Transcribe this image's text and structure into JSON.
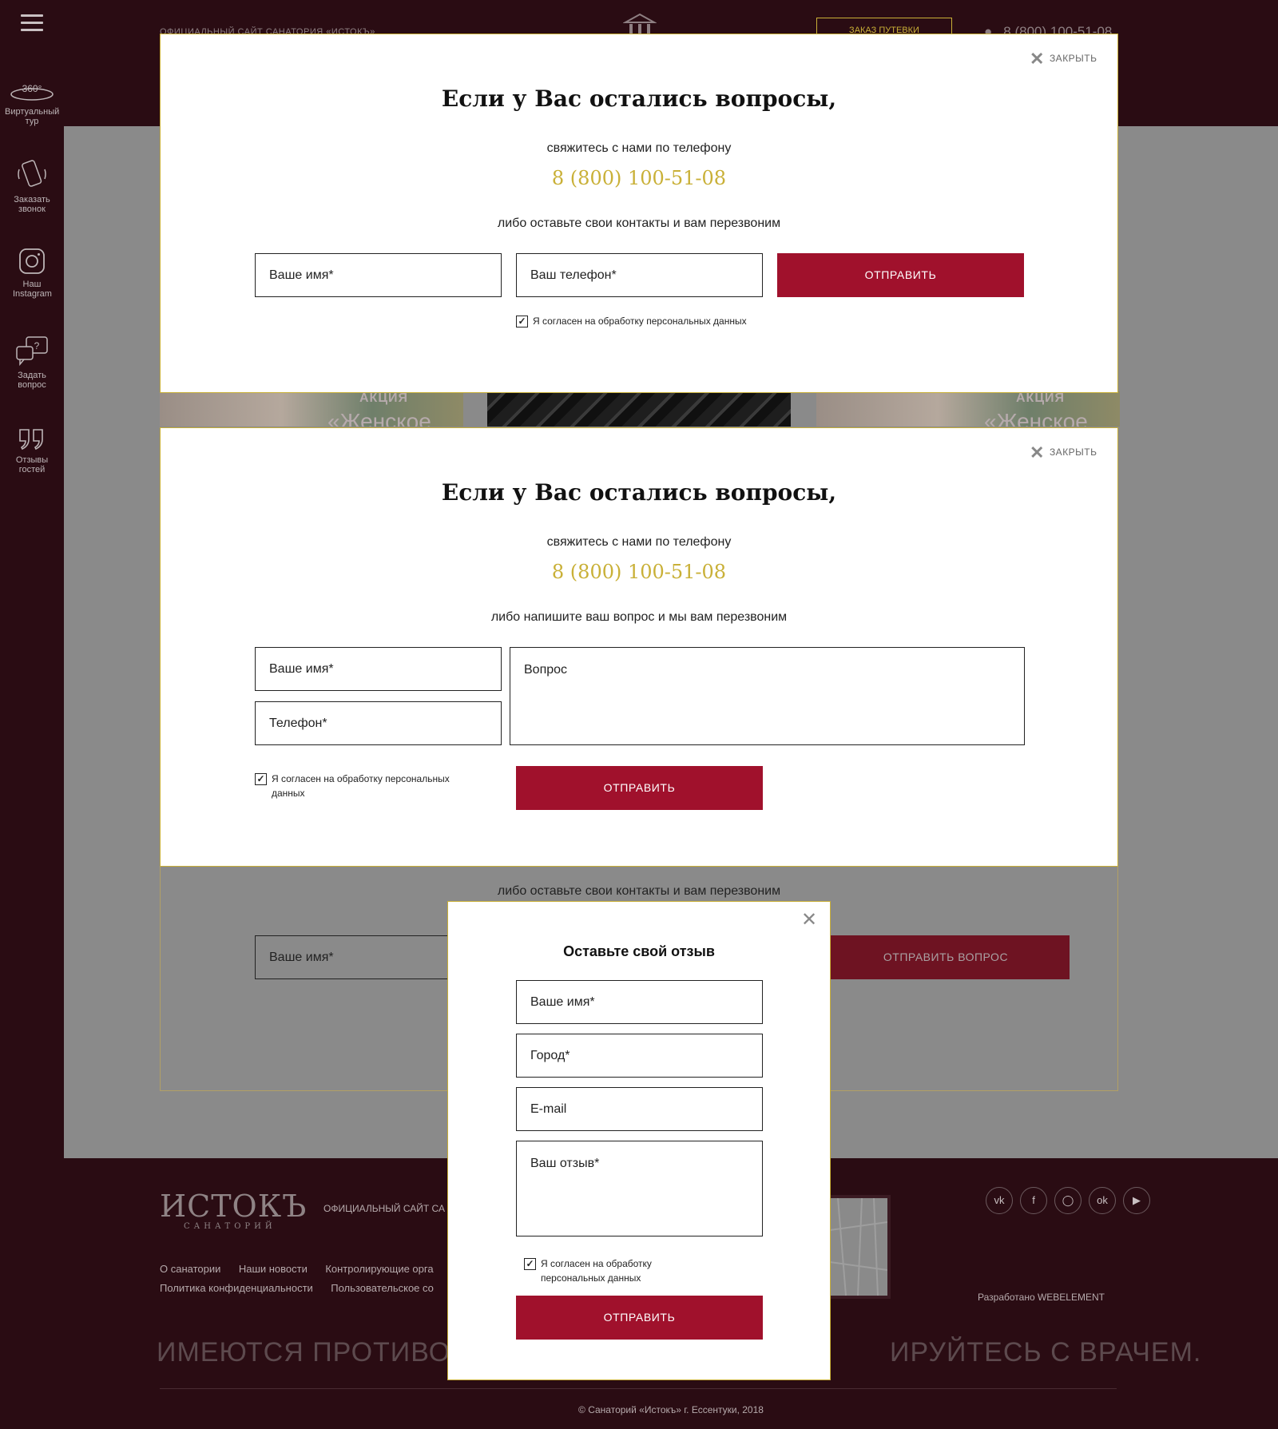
{
  "sidebar": {
    "items": [
      {
        "label": "Виртуальный тур",
        "icon": "360-icon",
        "badge": "360°"
      },
      {
        "label": "Заказать звонок",
        "icon": "phone-icon"
      },
      {
        "label": "Наш Instagram",
        "icon": "instagram-icon"
      },
      {
        "label": "Задать вопрос",
        "icon": "question-chat-icon"
      },
      {
        "label": "Отзывы гостей",
        "icon": "quote-icon"
      }
    ]
  },
  "header": {
    "site_label": "ОФИЦИАЛЬНЫЙ САЙТ САНАТОРИЯ «ИСТОКЪ»",
    "order_button": "ЗАКАЗ ПУТЕВКИ",
    "phone": "8 (800) 100-51-08"
  },
  "promos": [
    {
      "title": "АКЦИЯ",
      "big": "«Женское"
    },
    {
      "title": "",
      "big": ""
    },
    {
      "title": "АКЦИЯ",
      "big": "«Женское"
    }
  ],
  "background_form": {
    "subtitle": "либо оставьте свои контакты и вам перезвоним",
    "name_placeholder": "Ваше имя*",
    "submit": "ОТПРАВИТЬ ВОПРОС"
  },
  "modal_callback": {
    "close": "ЗАКРЫТЬ",
    "title": "Если у Вас остались вопросы,",
    "subtitle": "свяжитесь с нами по телефону",
    "phone": "8 (800) 100-51-08",
    "hint": "либо оставьте свои контакты и вам перезвоним",
    "name_placeholder": "Ваше имя*",
    "phone_placeholder": "Ваш телефон*",
    "submit": "ОТПРАВИТЬ",
    "consent": "Я согласен на обработку персональных данных"
  },
  "modal_question": {
    "close": "ЗАКРЫТЬ",
    "title": "Если у Вас остались вопросы,",
    "subtitle": "свяжитесь с нами по телефону",
    "phone": "8 (800) 100-51-08",
    "hint": "либо напишите ваш вопрос и мы вам перезвоним",
    "name_placeholder": "Ваше имя*",
    "phone_placeholder": "Телефон*",
    "question_placeholder": "Вопрос",
    "consent_line1": "Я согласен на обработку персональных",
    "consent_line2": "данных",
    "submit": "ОТПРАВИТЬ"
  },
  "modal_review": {
    "title": "Оставьте свой отзыв",
    "name_placeholder": "Ваше имя*",
    "city_placeholder": "Город*",
    "email_placeholder": "E-mail",
    "review_placeholder": "Ваш отзыв*",
    "consent_line1": "Я согласен на обработку",
    "consent_line2": "персональных данных",
    "submit": "ОТПРАВИТЬ"
  },
  "footer": {
    "logo_main": "ИСТОКЪ",
    "logo_sub": "САНАТОРИЙ",
    "site_label": "ОФИЦИАЛЬНЫЙ САЙТ СА",
    "links_row1": [
      "О санатории",
      "Наши новости",
      "Контролирующие орга"
    ],
    "links_row2": [
      "Политика конфиденциальности",
      "Пользовательское со"
    ],
    "warning_left": "ИМЕЮТСЯ ПРОТИВОП",
    "warning_right": "ИРУЙТЕСЬ С ВРАЧЕМ.",
    "developer": "Разработано WEBELEMENT",
    "copyright": "© Санаторий «Истокъ» г. Ессентуки, 2018",
    "socials": [
      "vk",
      "facebook",
      "instagram",
      "odnoklassniki",
      "youtube"
    ]
  },
  "colors": {
    "accent_gold": "#c9b037",
    "button_red": "#a0112c",
    "dark_bg": "#2a0c13"
  }
}
